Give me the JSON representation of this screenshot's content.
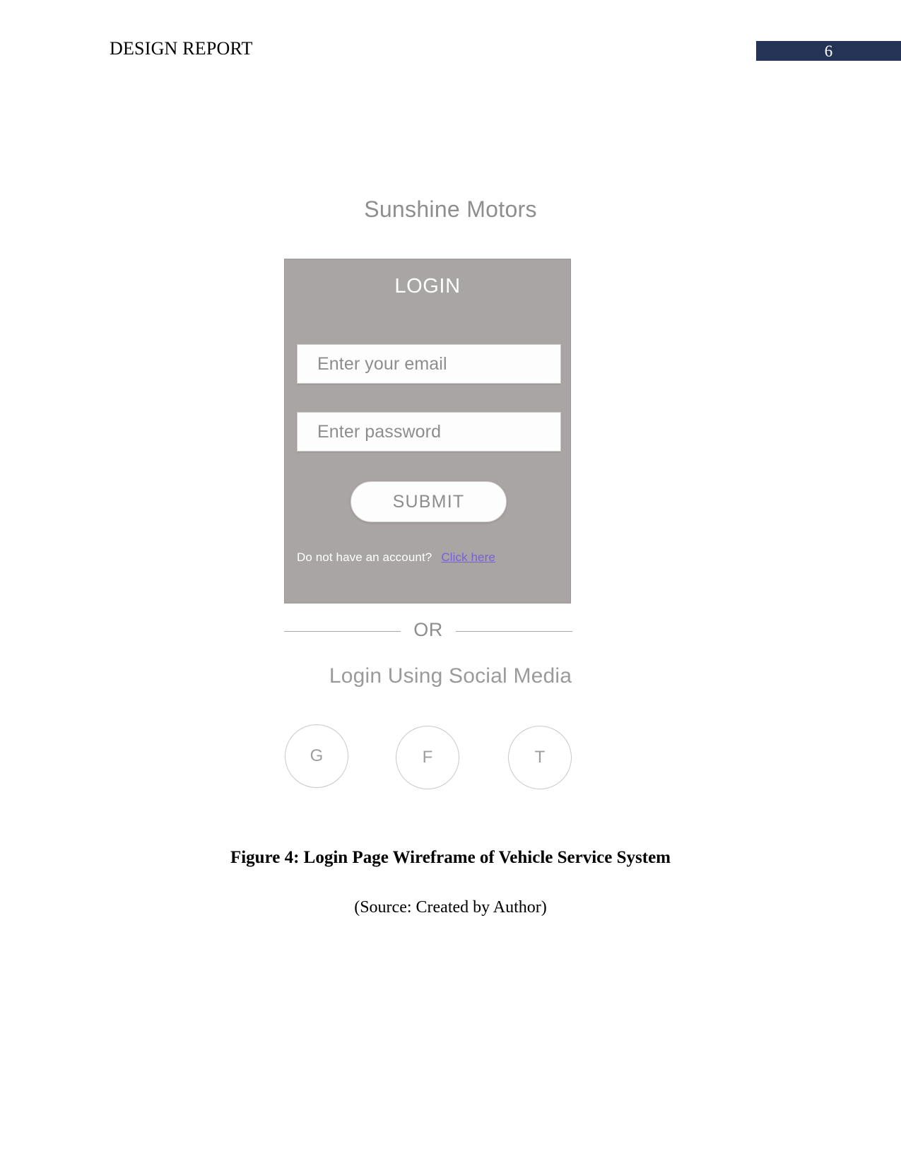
{
  "document": {
    "header_title": "DESIGN REPORT",
    "page_number": "6",
    "header_badge_color": "#243356"
  },
  "wireframe": {
    "brand_title": "Sunshine Motors",
    "card": {
      "heading": "LOGIN",
      "background_color": "#a9a5a4",
      "email_field": {
        "placeholder": "Enter your email"
      },
      "password_field": {
        "placeholder": "Enter password"
      },
      "submit_label": "SUBMIT",
      "signup_prompt": "Do not have an account?",
      "signup_link": "Click here",
      "signup_link_color": "#7b5fd6"
    },
    "divider_label": "OR",
    "social": {
      "heading": "Login Using Social Media",
      "buttons": [
        {
          "label": "G",
          "name": "google"
        },
        {
          "label": "F",
          "name": "facebook"
        },
        {
          "label": "T",
          "name": "twitter"
        }
      ]
    }
  },
  "captions": {
    "figure": "Figure 4: Login Page Wireframe of Vehicle Service System",
    "source": "(Source: Created by Author)"
  }
}
